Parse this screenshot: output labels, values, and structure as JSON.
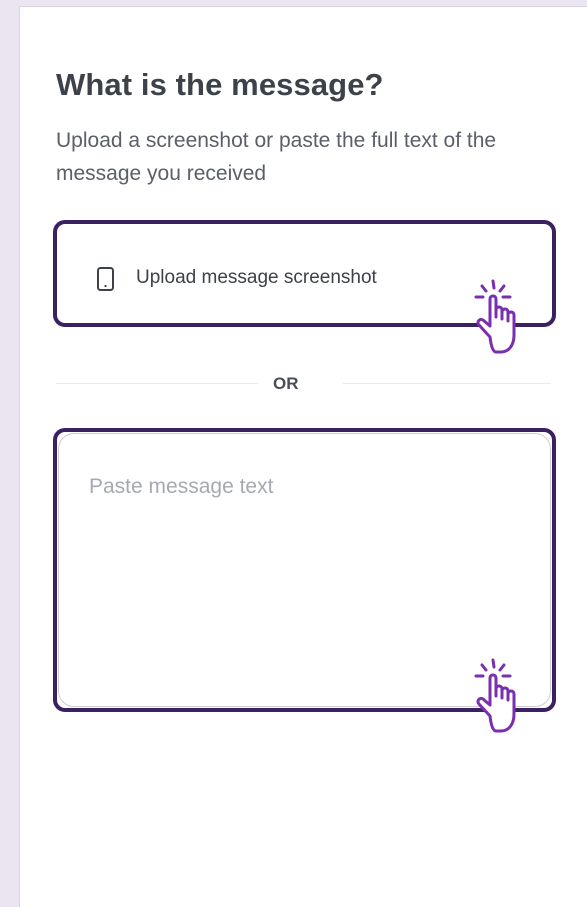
{
  "question": {
    "title": "What is the message?",
    "subtitle": "Upload a screenshot or paste the full text of the message you received"
  },
  "upload": {
    "label": "Upload message screenshot",
    "icon": "phone-icon"
  },
  "divider": {
    "label": "OR"
  },
  "paste": {
    "placeholder": "Paste message text",
    "value": ""
  },
  "colors": {
    "accent": "#3b2161",
    "cursor": "#7a2eb0",
    "background": "#ebe5f2",
    "title": "#3d4149",
    "placeholder": "#a6a9b1"
  },
  "cursors": [
    "pointer-hand-icon",
    "pointer-hand-icon"
  ]
}
